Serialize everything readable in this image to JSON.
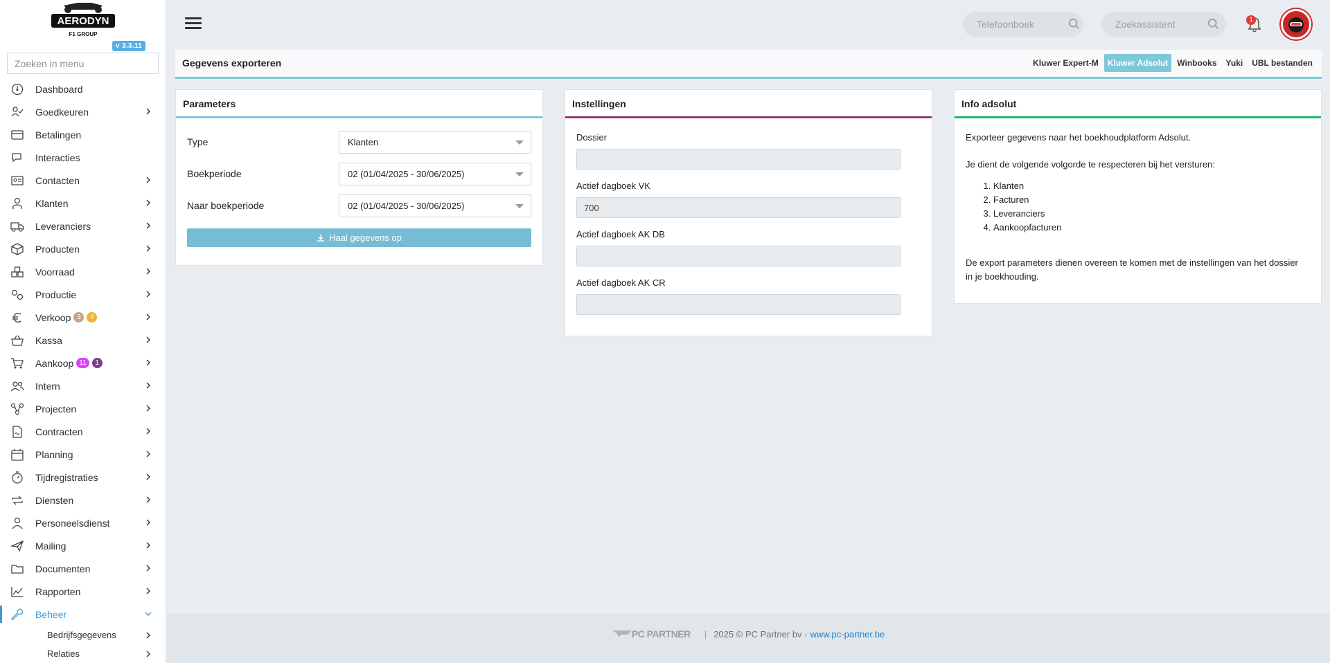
{
  "brand": {
    "logo_text": "AERODYN",
    "logo_sub": "F1 GROUP",
    "version": "v 3.3.11"
  },
  "menu_search": {
    "placeholder": "Zoeken in menu"
  },
  "menu": [
    {
      "label": "Dashboard",
      "icon": "dashboard-icon",
      "chevron": false
    },
    {
      "label": "Goedkeuren",
      "icon": "approve-icon",
      "chevron": true
    },
    {
      "label": "Betalingen",
      "icon": "payments-icon",
      "chevron": false
    },
    {
      "label": "Interacties",
      "icon": "chat-icon",
      "chevron": false
    },
    {
      "label": "Contacten",
      "icon": "contacts-icon",
      "chevron": true
    },
    {
      "label": "Klanten",
      "icon": "customer-icon",
      "chevron": true
    },
    {
      "label": "Leveranciers",
      "icon": "truck-icon",
      "chevron": true
    },
    {
      "label": "Producten",
      "icon": "box-icon",
      "chevron": true
    },
    {
      "label": "Voorraad",
      "icon": "stock-icon",
      "chevron": true
    },
    {
      "label": "Productie",
      "icon": "gears-icon",
      "chevron": true
    },
    {
      "label": "Verkoop",
      "icon": "euro-icon",
      "chevron": true,
      "badges": [
        {
          "text": "3",
          "color": "#c9a08a"
        },
        {
          "text": "4",
          "color": "#f0b429"
        }
      ]
    },
    {
      "label": "Kassa",
      "icon": "basket-icon",
      "chevron": true
    },
    {
      "label": "Aankoop",
      "icon": "cart-icon",
      "chevron": true,
      "badges": [
        {
          "text": "11",
          "color": "#e040fb"
        },
        {
          "text": "1",
          "color": "#7b3f8c"
        }
      ]
    },
    {
      "label": "Intern",
      "icon": "users-icon",
      "chevron": true
    },
    {
      "label": "Projecten",
      "icon": "project-icon",
      "chevron": true
    },
    {
      "label": "Contracten",
      "icon": "contract-icon",
      "chevron": true
    },
    {
      "label": "Planning",
      "icon": "calendar-icon",
      "chevron": true
    },
    {
      "label": "Tijdregistraties",
      "icon": "timer-icon",
      "chevron": true
    },
    {
      "label": "Diensten",
      "icon": "repeat-icon",
      "chevron": true
    },
    {
      "label": "Personeelsdienst",
      "icon": "person-icon",
      "chevron": true
    },
    {
      "label": "Mailing",
      "icon": "send-icon",
      "chevron": true
    },
    {
      "label": "Documenten",
      "icon": "folder-icon",
      "chevron": true
    },
    {
      "label": "Rapporten",
      "icon": "chart-icon",
      "chevron": true
    },
    {
      "label": "Beheer",
      "icon": "wrench-icon",
      "chevron": true,
      "active": true
    }
  ],
  "submenu": [
    {
      "label": "Bedrijfsgegevens"
    },
    {
      "label": "Relaties"
    }
  ],
  "topbar": {
    "search1_placeholder": "Telefoonboek",
    "search2_placeholder": "Zoekassistent",
    "notifications": "1"
  },
  "page": {
    "title": "Gegevens exporteren",
    "tabs": [
      {
        "label": "Kluwer Expert-M",
        "active": false
      },
      {
        "label": "Kluwer Adsolut",
        "active": true
      },
      {
        "label": "Winbooks",
        "active": false
      },
      {
        "label": "Yuki",
        "active": false
      },
      {
        "label": "UBL bestanden",
        "active": false
      }
    ]
  },
  "parameters": {
    "title": "Parameters",
    "type_label": "Type",
    "type_value": "Klanten",
    "period_label": "Boekperiode",
    "period_value": "02 (01/04/2025 - 30/06/2025)",
    "to_period_label": "Naar boekperiode",
    "to_period_value": "02 (01/04/2025 - 30/06/2025)",
    "button": "Haal gegevens op"
  },
  "instellingen": {
    "title": "Instellingen",
    "fields": [
      {
        "label": "Dossier",
        "value": ""
      },
      {
        "label": "Actief dagboek VK",
        "value": "700"
      },
      {
        "label": "Actief dagboek AK DB",
        "value": ""
      },
      {
        "label": "Actief dagboek AK CR",
        "value": ""
      }
    ]
  },
  "info": {
    "title": "Info adsolut",
    "intro": "Exporteer gegevens naar het boekhoudplatform Adsolut.",
    "order_text": "Je dient de volgende volgorde te respecteren bij het versturen:",
    "steps": [
      "Klanten",
      "Facturen",
      "Leveranciers",
      "Aankoopfacturen"
    ],
    "note": "De export parameters dienen overeen te komen met de instellingen van het dossier in je boekhouding."
  },
  "footer": {
    "logo": "PC PARTNER",
    "copyright": "2025 © PC Partner bv -",
    "link": "www.pc-partner.be"
  },
  "colors": {
    "accent": "#7ec8d8",
    "instellingen_border": "#8e3b7a",
    "info_border": "#22b573",
    "active_menu": "#3f9ad6"
  }
}
